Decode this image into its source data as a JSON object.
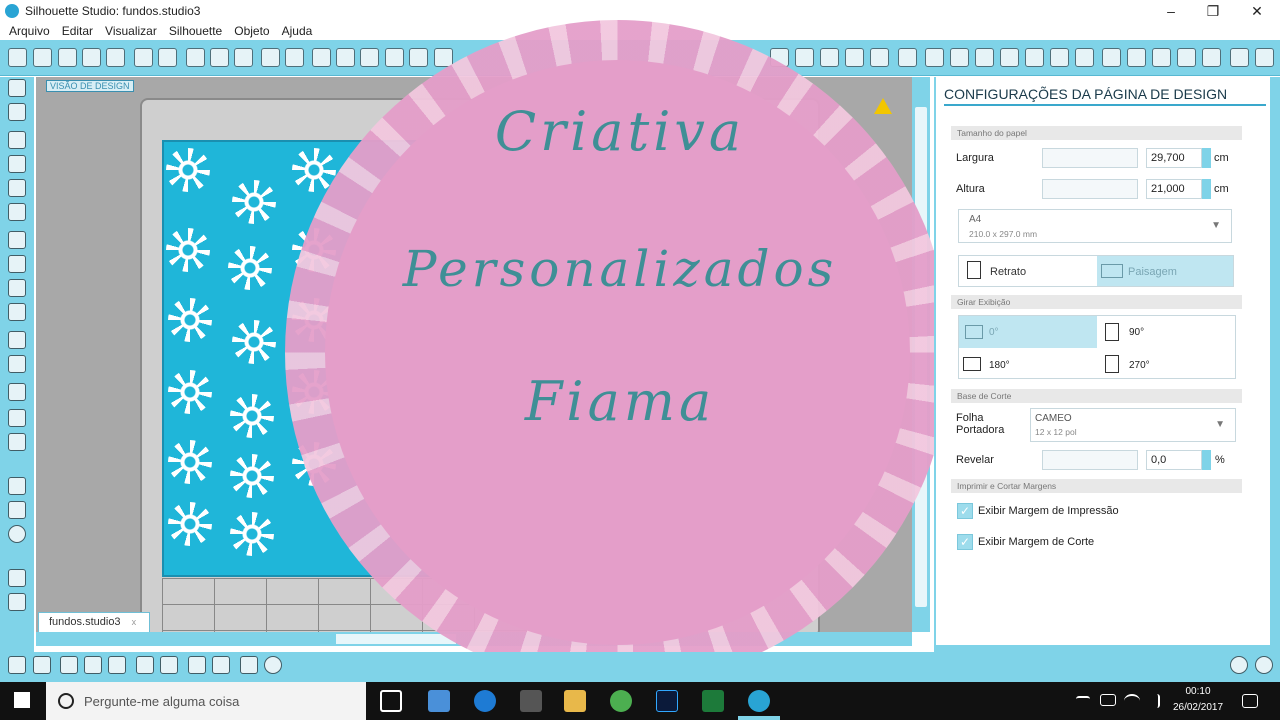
{
  "window": {
    "title": "Silhouette Studio: fundos.studio3",
    "minimize": "–",
    "restore": "❐",
    "close": "✕"
  },
  "menu": [
    "Arquivo",
    "Editar",
    "Visualizar",
    "Silhouette",
    "Objeto",
    "Ajuda"
  ],
  "canvas": {
    "view_label": "VISÃO DE DESIGN",
    "doc_tab": "fundos.studio3",
    "doc_tab_close": "x"
  },
  "overlay": {
    "line1": "Criativa",
    "line2": "Personalizados",
    "line3": "Fiama"
  },
  "panel": {
    "title": "CONFIGURAÇÕES DA PÁGINA DE DESIGN",
    "paper_section": "Tamanho do papel",
    "width_label": "Largura",
    "width_value": "29,700",
    "height_label": "Altura",
    "height_value": "21,000",
    "unit": "cm",
    "paper_size_name": "A4",
    "paper_size_dims": "210.0 x 297.0 mm",
    "portrait_label": "Retrato",
    "landscape_label": "Paisagem",
    "orientation_selected": "Paisagem",
    "rotate_section": "Girar Exibição",
    "rotations": [
      "0°",
      "90°",
      "180°",
      "270°"
    ],
    "rotation_selected": "0°",
    "base_section": "Base de Corte",
    "carrier_label_1": "Folha",
    "carrier_label_2": "Portadora",
    "carrier_name": "CAMEO",
    "carrier_size": "12 x 12 pol",
    "reveal_label": "Revelar",
    "reveal_value": "0,0",
    "reveal_unit": "%",
    "margins_section": "Imprimir e Cortar Margens",
    "show_print_margin": "Exibir Margem de Impressão",
    "show_cut_margin": "Exibir Margem de Corte"
  },
  "taskbar": {
    "search_placeholder": "Pergunte-me alguma coisa",
    "time": "00:10",
    "date": "26/02/2017"
  },
  "colors": {
    "accent": "#7fd3e8",
    "paper": "#1fb6d9",
    "doily": "#e49ec9",
    "script_text": "#3f8f96"
  }
}
